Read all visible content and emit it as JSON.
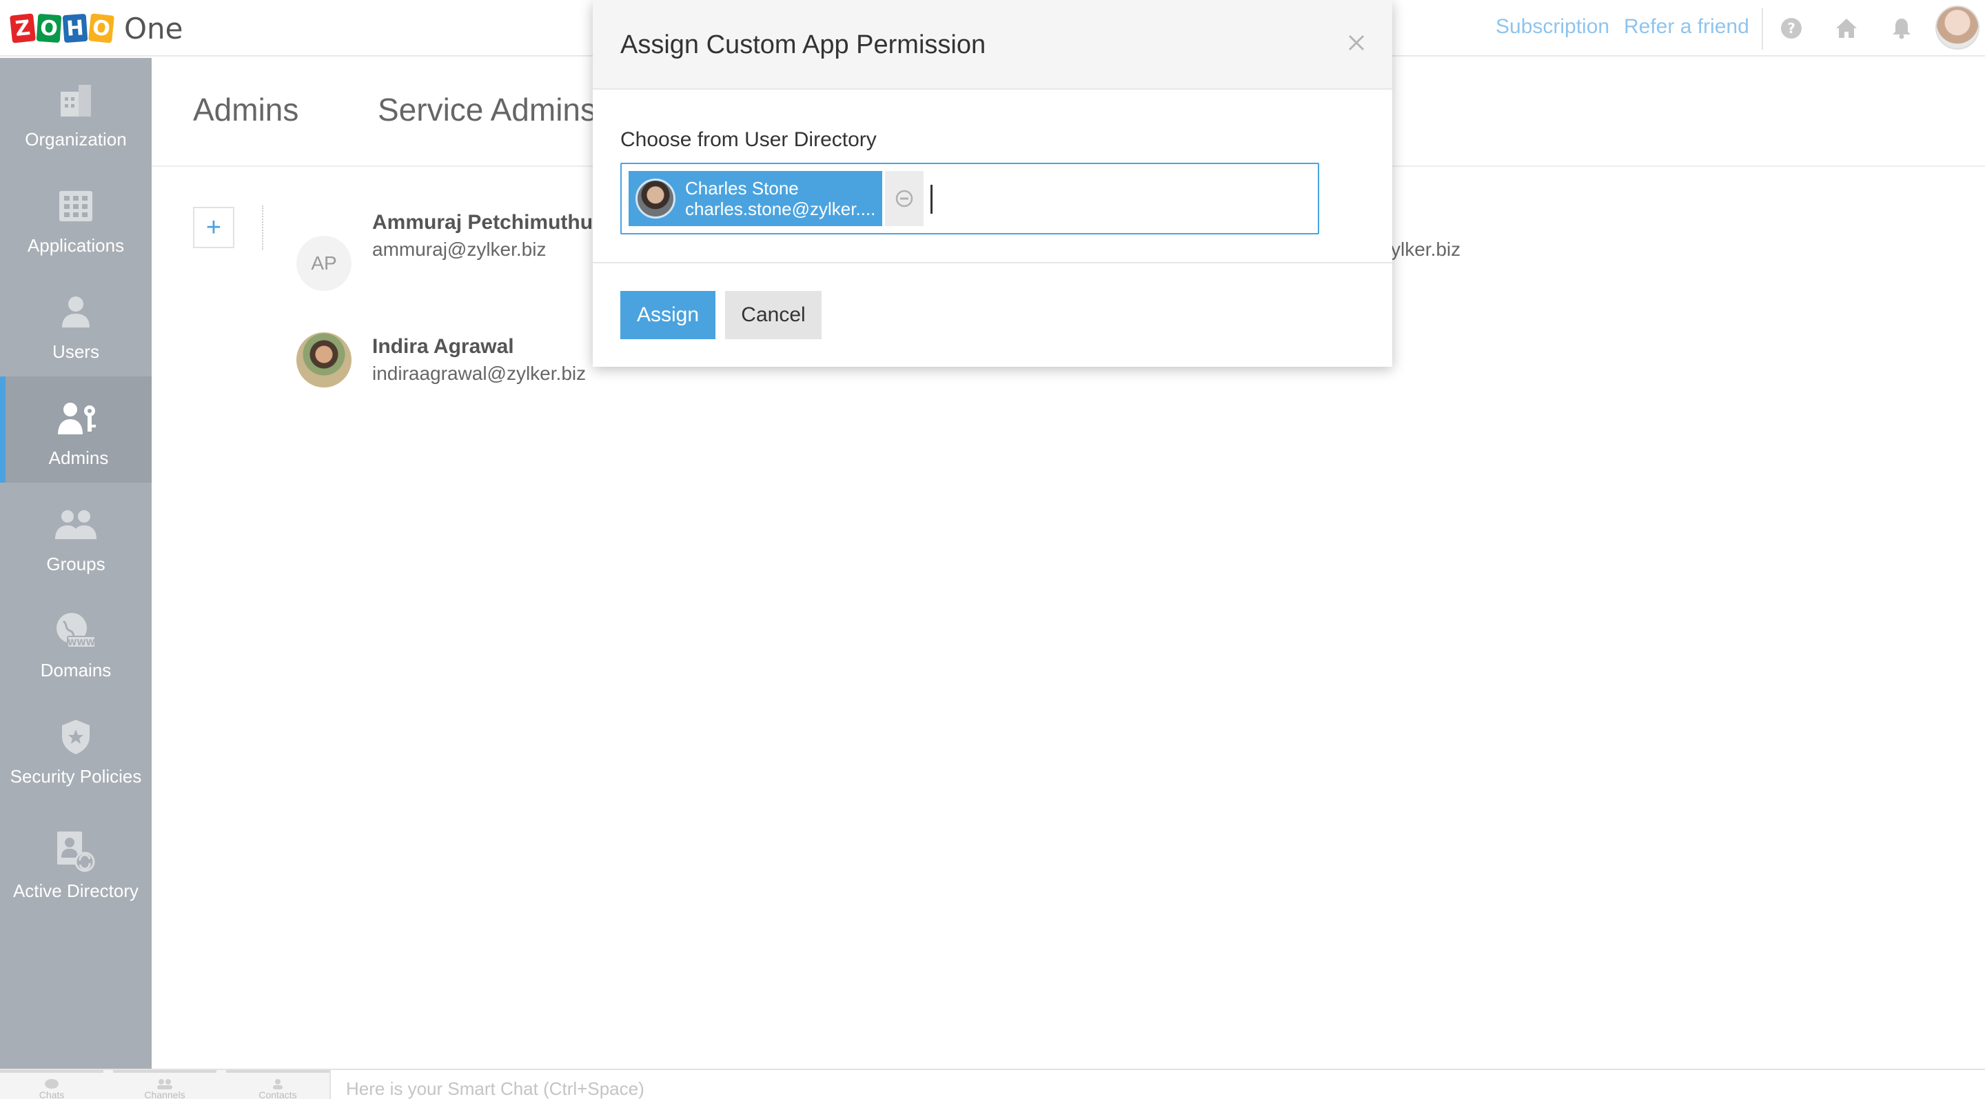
{
  "header": {
    "logo_letters": [
      "Z",
      "O",
      "H",
      "O"
    ],
    "logo_colors": [
      "#e42527",
      "#089949",
      "#226db4",
      "#f9b21d"
    ],
    "logo_suffix": "One",
    "links": [
      {
        "label": "Subscription"
      },
      {
        "label": "Refer a friend"
      }
    ],
    "icons": [
      "help-icon",
      "home-icon",
      "bell-icon"
    ]
  },
  "sidebar": {
    "items": [
      {
        "label": "Organization",
        "icon": "building-icon"
      },
      {
        "label": "Applications",
        "icon": "grid-icon"
      },
      {
        "label": "Users",
        "icon": "user-icon"
      },
      {
        "label": "Admins",
        "icon": "admin-key-icon",
        "active": true
      },
      {
        "label": "Groups",
        "icon": "group-icon"
      },
      {
        "label": "Domains",
        "icon": "globe-www-icon"
      },
      {
        "label": "Security Policies",
        "icon": "shield-star-icon"
      },
      {
        "label": "Active Directory",
        "icon": "directory-sync-icon"
      }
    ]
  },
  "main": {
    "tabs": [
      {
        "label": "Admins"
      },
      {
        "label": "Service Admins"
      }
    ],
    "add_label": "+",
    "admins": [
      {
        "initials": "AP",
        "name": "Ammuraj Petchimuthu",
        "email": "ammuraj@zylker.biz"
      },
      {
        "initials": "",
        "name": "Indira Agrawal",
        "email": "indiraagrawal@zylker.biz"
      }
    ],
    "partial_email": "ylker.biz"
  },
  "modal": {
    "title": "Assign Custom App Permission",
    "field_label": "Choose from User Directory",
    "selected_user": {
      "name": "Charles Stone",
      "email": "charles.stone@zylker...."
    },
    "input_value": "",
    "assign_label": "Assign",
    "cancel_label": "Cancel"
  },
  "bottombar": {
    "tabs": [
      {
        "label": "Chats"
      },
      {
        "label": "Channels"
      },
      {
        "label": "Contacts"
      }
    ],
    "chat_placeholder": "Here is your Smart Chat (Ctrl+Space)"
  },
  "colors": {
    "accent": "#4aa3df",
    "sidebar_bg": "#a8aeb5",
    "link": "#8ec4ee"
  }
}
